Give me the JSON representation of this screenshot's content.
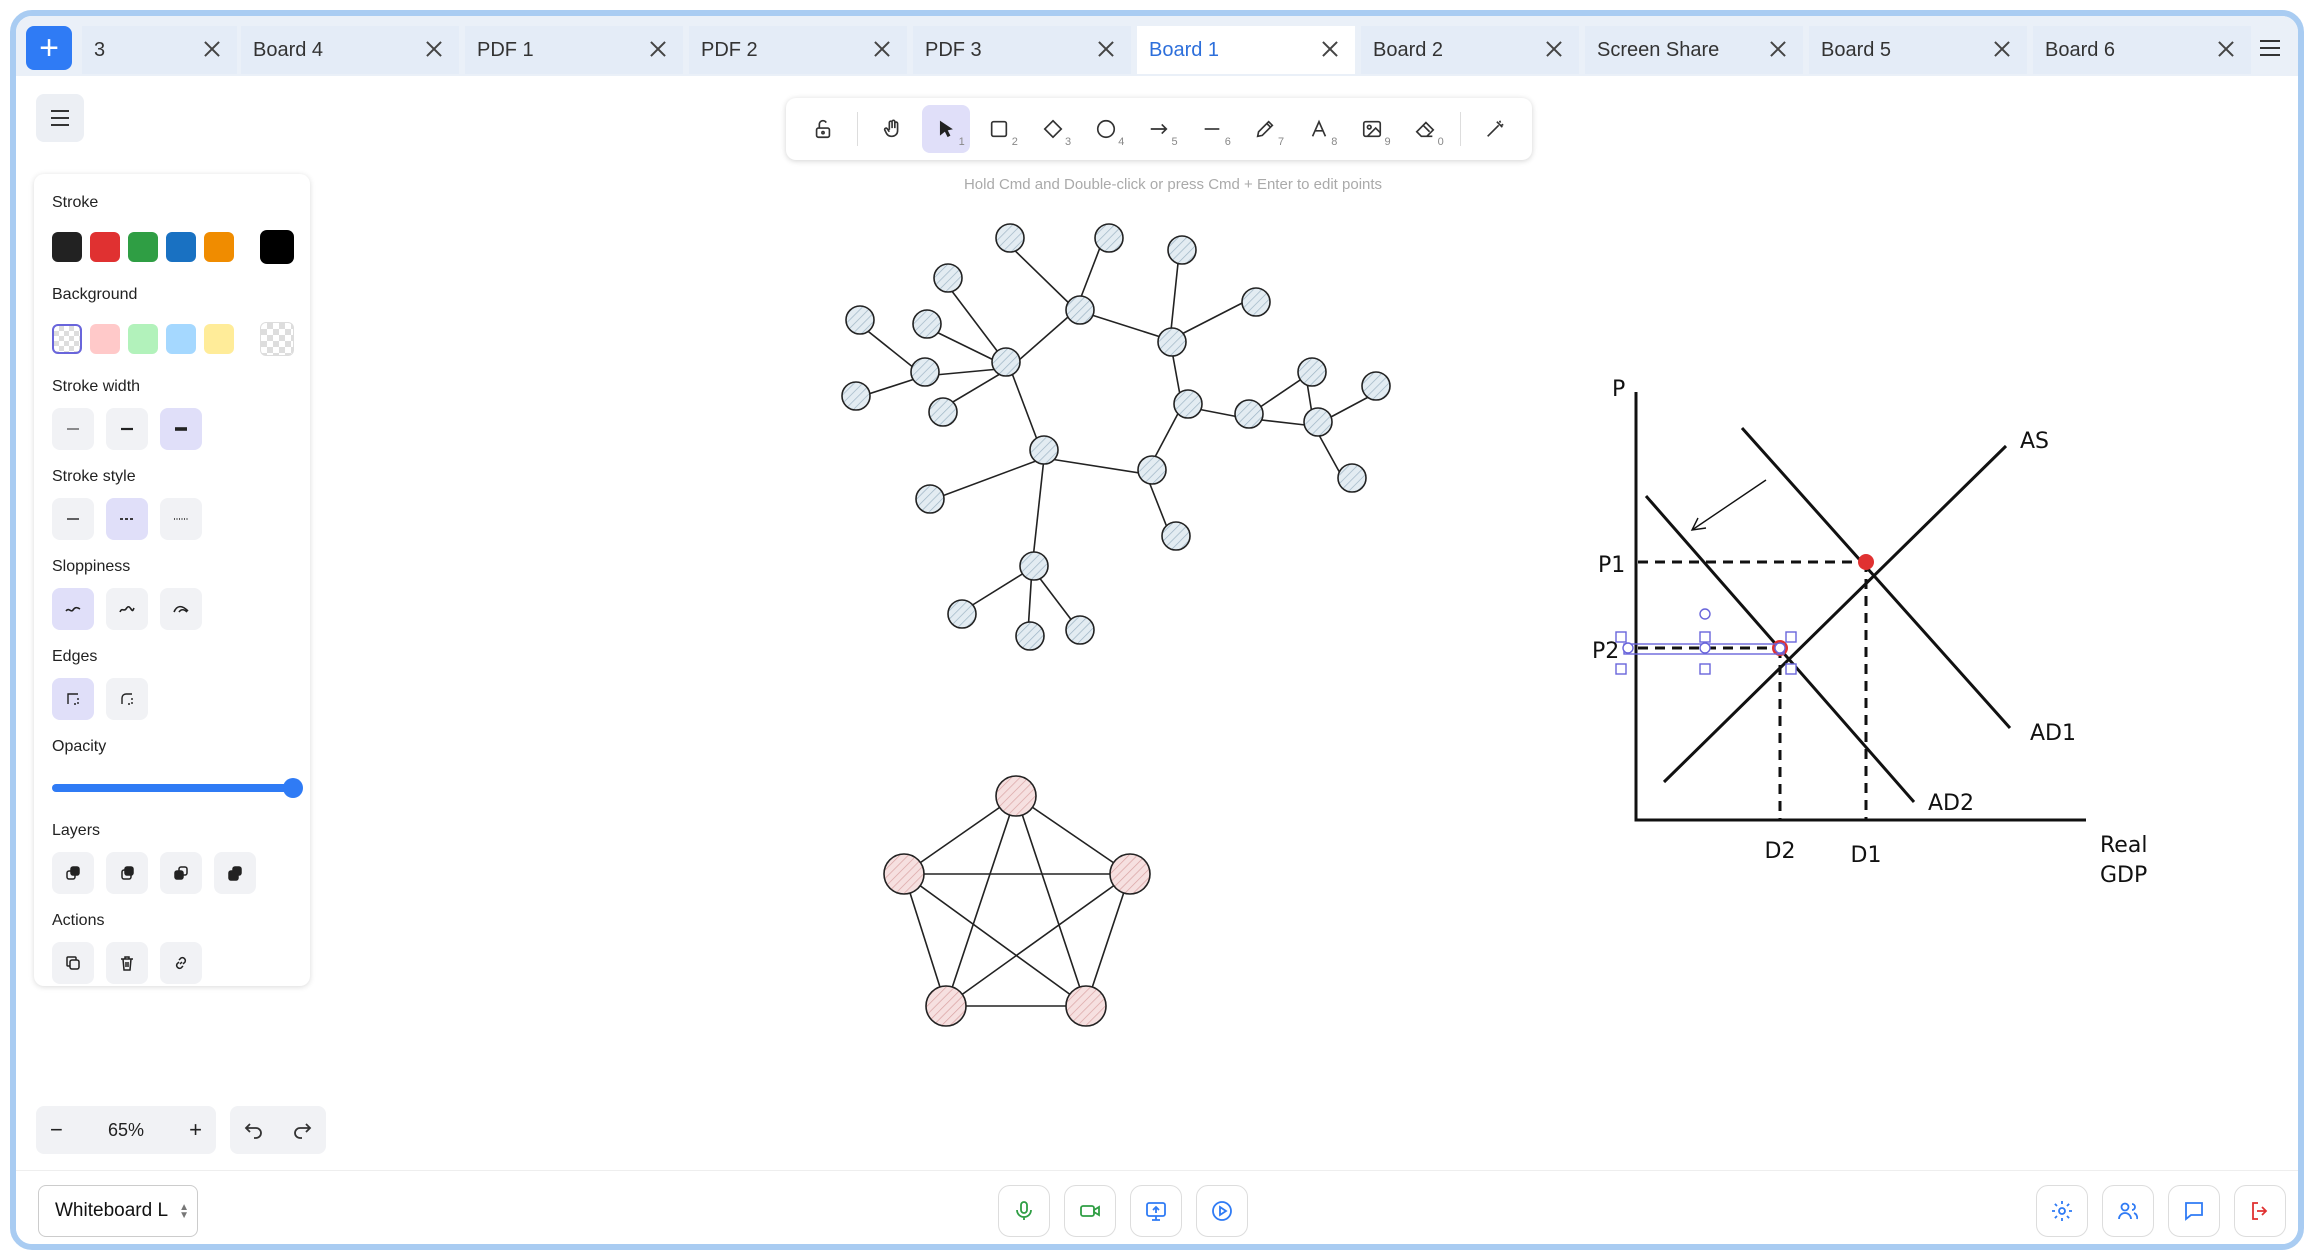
{
  "tabs": [
    {
      "label": "3",
      "active": false
    },
    {
      "label": "Board 4",
      "active": false
    },
    {
      "label": "PDF 1",
      "active": false
    },
    {
      "label": "PDF 2",
      "active": false
    },
    {
      "label": "PDF 3",
      "active": false
    },
    {
      "label": "Board 1",
      "active": true
    },
    {
      "label": "Board 2",
      "active": false
    },
    {
      "label": "Screen Share",
      "active": false
    },
    {
      "label": "Board 5",
      "active": false
    },
    {
      "label": "Board 6",
      "active": false
    }
  ],
  "toolbar": {
    "hint": "Hold Cmd and Double-click or press Cmd + Enter to edit points",
    "tool_numbers": [
      "1",
      "2",
      "3",
      "4",
      "5",
      "6",
      "7",
      "8",
      "9",
      "0"
    ]
  },
  "panel": {
    "stroke_label": "Stroke",
    "background_label": "Background",
    "stroke_width_label": "Stroke width",
    "stroke_style_label": "Stroke style",
    "sloppiness_label": "Sloppiness",
    "edges_label": "Edges",
    "opacity_label": "Opacity",
    "layers_label": "Layers",
    "actions_label": "Actions",
    "stroke_colors": [
      "#222222",
      "#e03131",
      "#2f9e44",
      "#1971c2",
      "#f08c00"
    ],
    "stroke_current": "#000000",
    "background_colors": [
      "transparent",
      "#ffc9c9",
      "#b2f2bb",
      "#a5d8ff",
      "#ffec99"
    ],
    "opacity_value": 100
  },
  "zoom": {
    "value": "65%"
  },
  "bottom": {
    "whiteboard_select": "Whiteboard L"
  },
  "graph": {
    "labels": {
      "p": "P",
      "as": "AS",
      "p1": "P1",
      "p2": "P2",
      "ad1": "AD1",
      "ad2": "AD2",
      "d2": "D2",
      "d1": "D1",
      "real": "Real",
      "gdp": "GDP"
    }
  },
  "colors": {
    "accent": "#2f7bf5",
    "tab_active_text": "#2d6fdb",
    "frame_border": "#a9ccf2",
    "node_blue": "#cfdde6",
    "node_red": "#f2cfcf",
    "point_red": "#e03131"
  }
}
